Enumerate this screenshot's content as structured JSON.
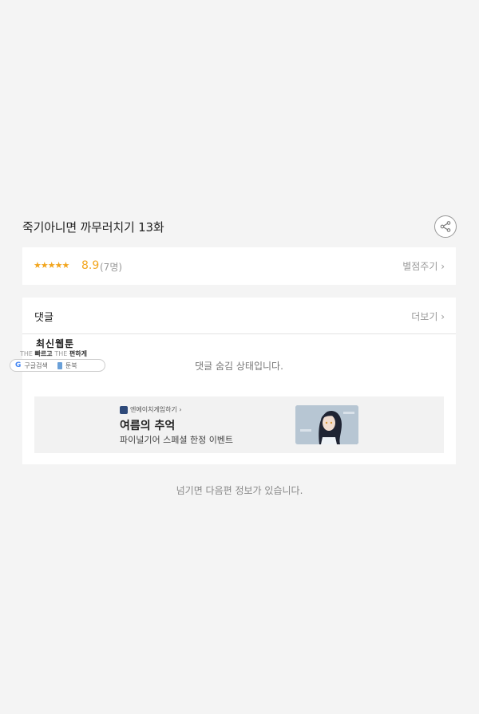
{
  "episode": {
    "title": "죽기아니면 까무러치기 13화"
  },
  "rating": {
    "stars_text": "★★★★★",
    "score": "8.9",
    "count": "(7명)",
    "rate_link": "별점주기 ›",
    "accent_color": "#f2a51d"
  },
  "comments": {
    "label": "댓글",
    "more_link": "더보기 ›",
    "hidden_message": "댓글 숨김 상태입니다."
  },
  "ad": {
    "brand": "엔에이치게임하기 ›",
    "headline": "여름의 추억",
    "subtext": "파이널기어 스페셜 한정 이벤트"
  },
  "overlay": {
    "title": "최신웹툰",
    "tagline_the1": "THE ",
    "tagline_fast": "빠르고 ",
    "tagline_the2": "THE ",
    "tagline_easy": "편하게",
    "search_google": "구글검색",
    "search_toonbook": "툰북"
  },
  "footer": {
    "next_info": "넘기면 다음편 정보가 있습니다."
  },
  "icons": {
    "share": "share-icon"
  }
}
